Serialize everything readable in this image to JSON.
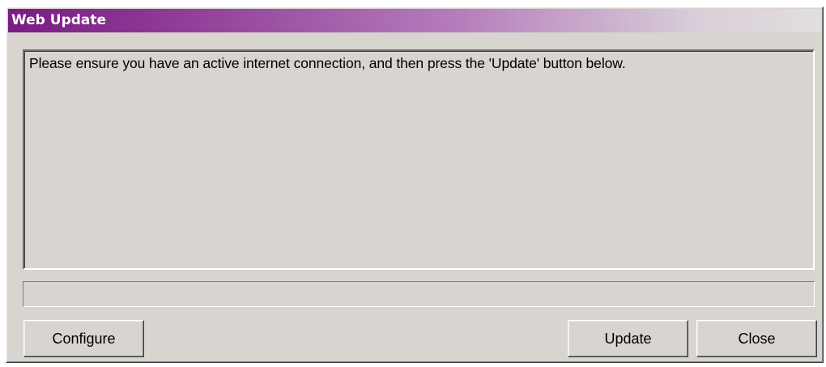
{
  "window": {
    "title": "Web Update"
  },
  "message": {
    "text": "Please ensure you have an active internet connection, and then press the 'Update' button below."
  },
  "progress": {
    "value": 0
  },
  "buttons": {
    "configure_label": "Configure",
    "update_label": "Update",
    "close_label": "Close"
  },
  "colors": {
    "titlebar_start": "#7a1b84",
    "titlebar_end": "#e2dede",
    "dialog_background": "#d8d4cf"
  }
}
